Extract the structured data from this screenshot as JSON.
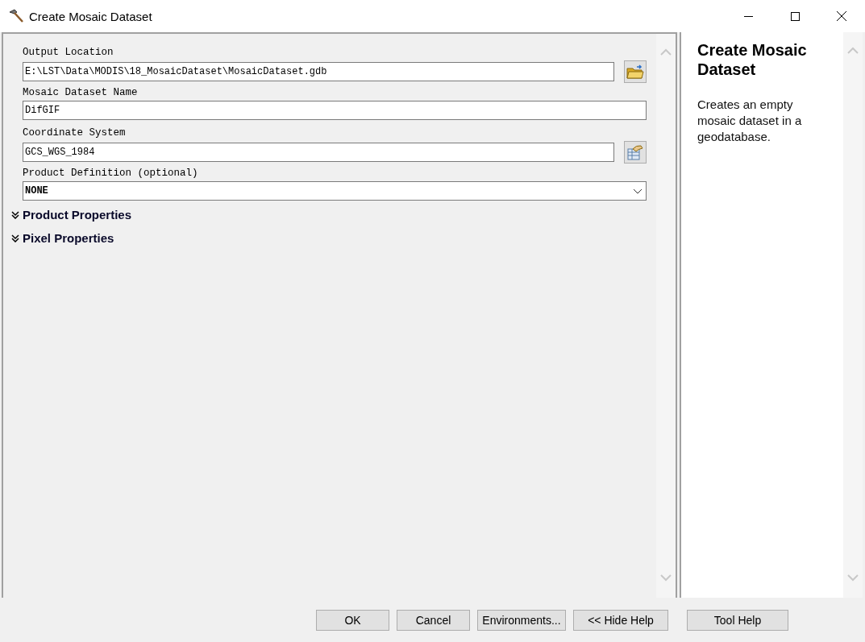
{
  "window": {
    "title": "Create Mosaic Dataset"
  },
  "parameters": [
    {
      "kind": "path",
      "label": "Output Location",
      "value": "E:\\LST\\Data\\MODIS\\18_MosaicDataset\\MosaicDataset.gdb",
      "browse_button": {
        "kind": "folder"
      }
    },
    {
      "kind": "text",
      "label": "Mosaic Dataset Name",
      "value": "DifGIF"
    },
    {
      "kind": "path",
      "label": "Coordinate System",
      "value": "GCS_WGS_1984",
      "browse_button": {
        "kind": "properties"
      }
    },
    {
      "kind": "dropdown",
      "label": "Product Definition (optional)",
      "value": "NONE"
    }
  ],
  "sections": [
    {
      "label": "Product Properties",
      "expanded": false
    },
    {
      "label": "Pixel Properties",
      "expanded": false
    }
  ],
  "help": {
    "title": "Create Mosaic Dataset",
    "description": "Creates an empty mosaic dataset in a geodatabase."
  },
  "buttons": [
    "OK",
    "Cancel",
    "Environments...",
    "<< Hide Help",
    "Tool Help"
  ]
}
